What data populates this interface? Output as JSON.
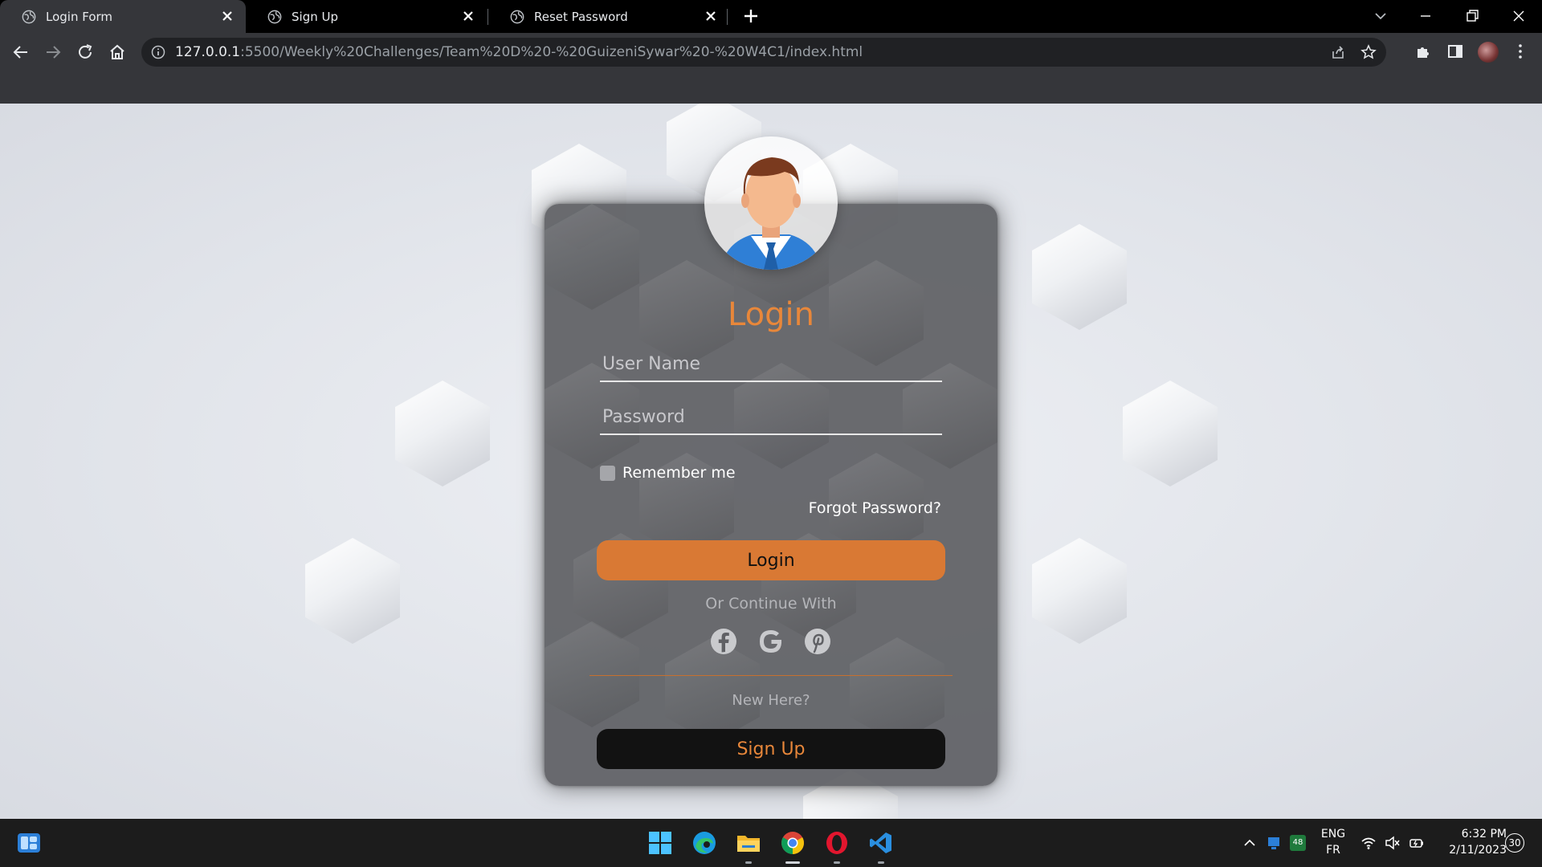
{
  "browser": {
    "tabs": [
      {
        "title": "Login Form",
        "active": true
      },
      {
        "title": "Sign Up",
        "active": false
      },
      {
        "title": "Reset Password",
        "active": false
      }
    ],
    "url_host": "127.0.0.1",
    "url_rest": ":5500/Weekly%20Challenges/Team%20D%20-%20GuizeniSywar%20-%20W4C1/index.html"
  },
  "login": {
    "title": "Login",
    "username_placeholder": "User Name",
    "password_placeholder": "Password",
    "remember_label": "Remember me",
    "forgot_label": "Forgot Password?",
    "login_button": "Login",
    "or_continue": "Or Continue With",
    "social": [
      "facebook-icon",
      "google-icon",
      "pinterest-icon"
    ],
    "new_here": "New Here?",
    "signup_button": "Sign Up"
  },
  "colors": {
    "accent": "#e8873a",
    "login_button_bg": "#d97934",
    "card_bg": "#5f6064",
    "signup_button_bg": "#121212"
  },
  "taskbar": {
    "apps": [
      "windows-start-icon",
      "edge-icon",
      "file-explorer-icon",
      "chrome-icon",
      "opera-icon",
      "vscode-icon"
    ],
    "language_top": "ENG",
    "language_bottom": "FR",
    "time": "6:32 PM",
    "date": "2/11/2023",
    "notification_count": "30",
    "badge_48": "48"
  }
}
